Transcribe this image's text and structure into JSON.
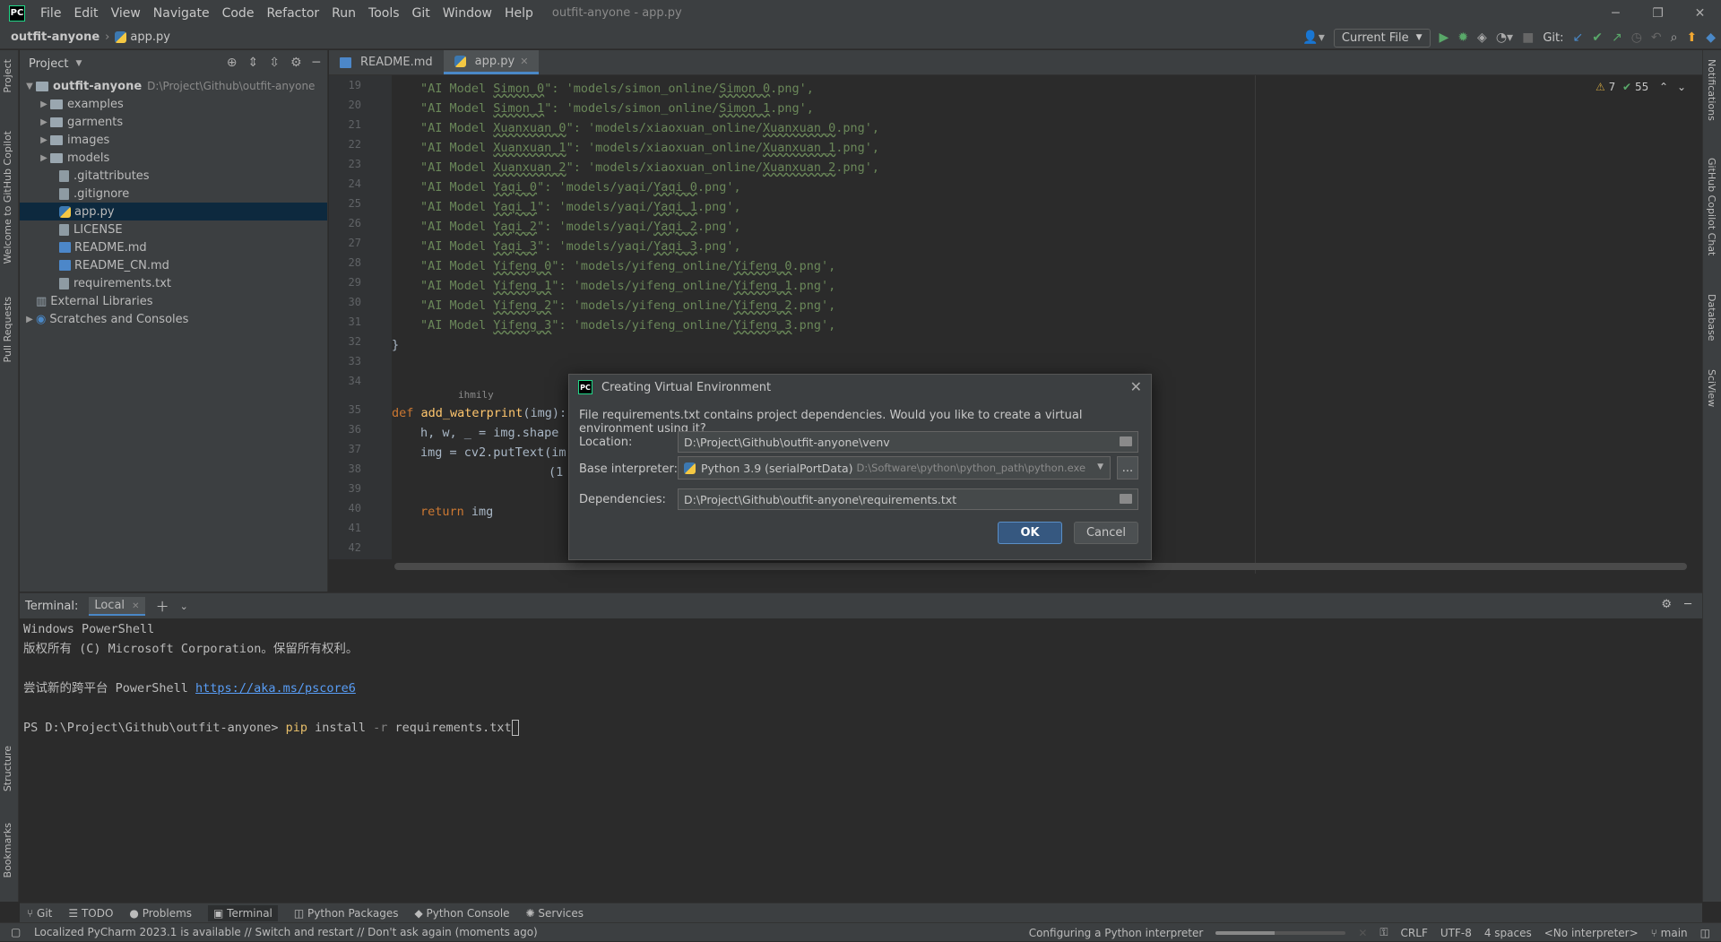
{
  "app": {
    "logo": "PC",
    "window_title": "outfit-anyone - app.py",
    "menu": [
      "File",
      "Edit",
      "View",
      "Navigate",
      "Code",
      "Refactor",
      "Run",
      "Tools",
      "Git",
      "Window",
      "Help"
    ]
  },
  "navbar": {
    "breadcrumb_project": "outfit-anyone",
    "breadcrumb_file": "app.py",
    "run_config": "Current File",
    "git_label": "Git:"
  },
  "side_tabs": {
    "left": [
      "Project",
      "Welcome to GitHub Copilot",
      "Pull Requests",
      "Structure",
      "Bookmarks"
    ],
    "right": [
      "Notifications",
      "GitHub Copilot Chat",
      "Database",
      "SciView"
    ]
  },
  "project_panel": {
    "title": "Project",
    "root": {
      "name": "outfit-anyone",
      "path": "D:\\Project\\Github\\outfit-anyone"
    },
    "folders": [
      "examples",
      "garments",
      "images",
      "models"
    ],
    "files": [
      ".gitattributes",
      ".gitignore",
      "app.py",
      "LICENSE",
      "README.md",
      "README_CN.md",
      "requirements.txt"
    ],
    "selected": "app.py",
    "external": "External Libraries",
    "scratches": "Scratches and Consoles"
  },
  "editor": {
    "tabs": [
      {
        "label": "README.md"
      },
      {
        "label": "app.py"
      }
    ],
    "inspections": {
      "warnings": "7",
      "ok": "55"
    },
    "line_numbers": [
      "19",
      "20",
      "21",
      "22",
      "23",
      "24",
      "25",
      "26",
      "27",
      "28",
      "29",
      "30",
      "31",
      "32",
      "33",
      "34",
      "35",
      "36",
      "37",
      "38",
      "39",
      "40",
      "41",
      "42"
    ],
    "model_lines": [
      {
        "key": "\"AI Model ",
        "name": "Simon_0",
        "mid": "\": 'models/simon_online/",
        "file": "Simon_0",
        "end": ".png',"
      },
      {
        "key": "\"AI Model ",
        "name": "Simon_1",
        "mid": "\": 'models/simon_online/",
        "file": "Simon_1",
        "end": ".png',"
      },
      {
        "key": "\"AI Model ",
        "name": "Xuanxuan_0",
        "mid": "\": 'models/xiaoxuan_online/",
        "file": "Xuanxuan_0",
        "end": ".png',"
      },
      {
        "key": "\"AI Model ",
        "name": "Xuanxuan_1",
        "mid": "\": 'models/xiaoxuan_online/",
        "file": "Xuanxuan_1",
        "end": ".png',"
      },
      {
        "key": "\"AI Model ",
        "name": "Xuanxuan_2",
        "mid": "\": 'models/xiaoxuan_online/",
        "file": "Xuanxuan_2",
        "end": ".png',"
      },
      {
        "key": "\"AI Model ",
        "name": "Yaqi_0",
        "mid": "\": 'models/yaqi/",
        "file": "Yaqi_0",
        "end": ".png',"
      },
      {
        "key": "\"AI Model ",
        "name": "Yaqi_1",
        "mid": "\": 'models/yaqi/",
        "file": "Yaqi_1",
        "end": ".png',"
      },
      {
        "key": "\"AI Model ",
        "name": "Yaqi_2",
        "mid": "\": 'models/yaqi/",
        "file": "Yaqi_2",
        "end": ".png',"
      },
      {
        "key": "\"AI Model ",
        "name": "Yaqi_3",
        "mid": "\": 'models/yaqi/",
        "file": "Yaqi_3",
        "end": ".png',"
      },
      {
        "key": "\"AI Model ",
        "name": "Yifeng_0",
        "mid": "\": 'models/yifeng_online/",
        "file": "Yifeng_0",
        "end": ".png',"
      },
      {
        "key": "\"AI Model ",
        "name": "Yifeng_1",
        "mid": "\": 'models/yifeng_online/",
        "file": "Yifeng_1",
        "end": ".png',"
      },
      {
        "key": "\"AI Model ",
        "name": "Yifeng_2",
        "mid": "\": 'models/yifeng_online/",
        "file": "Yifeng_2",
        "end": ".png',"
      },
      {
        "key": "\"AI Model ",
        "name": "Yifeng_3",
        "mid": "\": 'models/yifeng_online/",
        "file": "Yifeng_3",
        "end": ".png',"
      }
    ],
    "closing_brace": "}",
    "author": "ihmily",
    "def_kw": "def ",
    "def_name": "add_waterprint",
    "def_rest": "(img):",
    "line36": "h, w, _ = img.shape",
    "line37": "img = cv2.putText(im",
    "line38": "(1",
    "return_kw": "return ",
    "return_rest": "img"
  },
  "dialog": {
    "title": "Creating Virtual Environment",
    "message": "File requirements.txt contains project dependencies. Would you like to create a virtual environment using it?",
    "location_label": "Location:",
    "location_value": "D:\\Project\\Github\\outfit-anyone\\venv",
    "interpreter_label": "Base interpreter:",
    "interpreter_name": "Python 3.9 (serialPortData)",
    "interpreter_path": "D:\\Software\\python\\python_path\\python.exe",
    "more_button": "...",
    "dependencies_label": "Dependencies:",
    "dependencies_value": "D:\\Project\\Github\\outfit-anyone\\requirements.txt",
    "ok": "OK",
    "cancel": "Cancel"
  },
  "terminal": {
    "label": "Terminal:",
    "tab": "Local",
    "lines": [
      "Windows PowerShell",
      "版权所有 (C) Microsoft Corporation。保留所有权利。"
    ],
    "try_text": "尝试新的跨平台 PowerShell ",
    "try_link": "https://aka.ms/pscore6",
    "prompt": "PS D:\\Project\\Github\\outfit-anyone> ",
    "cmd": "pip",
    "cmd_rest": " install ",
    "flag": "-r",
    "arg": " requirements.txt"
  },
  "tool_windows": [
    "Git",
    "TODO",
    "Problems",
    "Terminal",
    "Python Packages",
    "Python Console",
    "Services"
  ],
  "tool_window_active": "Terminal",
  "status": {
    "message": "Localized PyCharm 2023.1 is available // Switch and restart // Don't ask again (moments ago)",
    "task": "Configuring a Python interpreter",
    "task_progress": 0.45,
    "line_sep": "CRLF",
    "encoding": "UTF-8",
    "indent": "4 spaces",
    "interpreter": "<No interpreter>",
    "branch": "main"
  }
}
